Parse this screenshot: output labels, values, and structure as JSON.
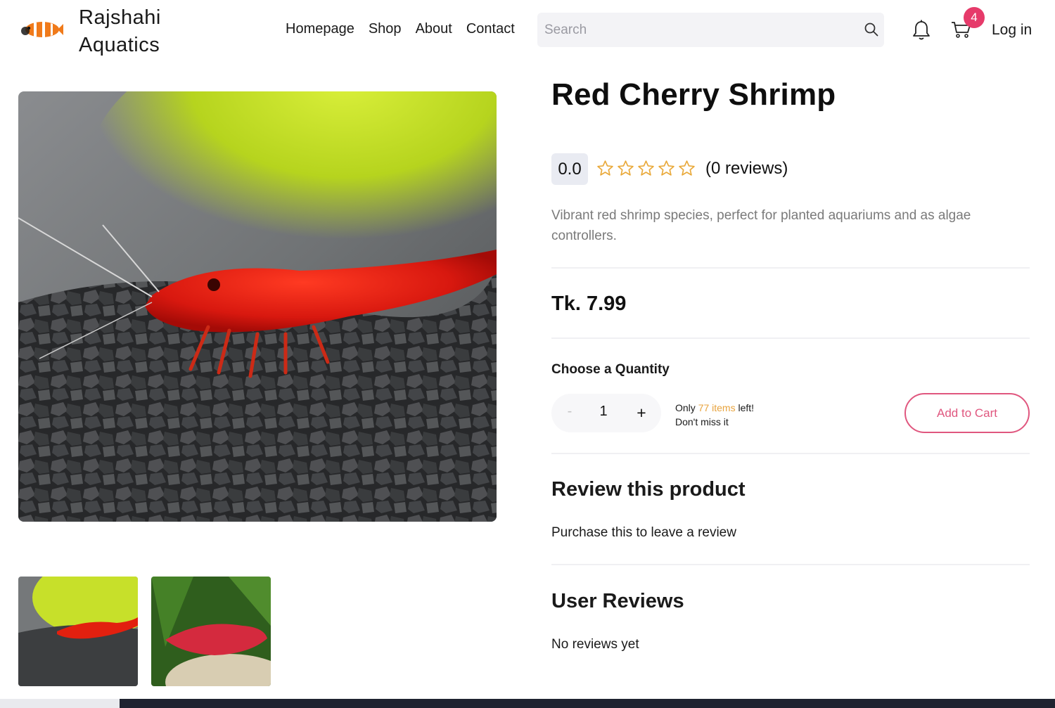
{
  "header": {
    "brand_line1": "Rajshahi",
    "brand_line2": "Aquatics",
    "nav": [
      "Homepage",
      "Shop",
      "About",
      "Contact"
    ],
    "search_placeholder": "Search",
    "cart_count": "4",
    "login_label": "Log in"
  },
  "product": {
    "title": "Red Cherry Shrimp",
    "rating": "0.0",
    "stars_filled": 0,
    "stars_total": 5,
    "reviews_label": "(0 reviews)",
    "description": "Vibrant red shrimp species, perfect for planted aquariums and as algae controllers.",
    "price": "Tk. 7.99",
    "quantity_heading": "Choose a Quantity",
    "quantity_value": "1",
    "minus_label": "-",
    "plus_label": "+",
    "stock_only": "Only",
    "stock_count": "77 items",
    "stock_left": "left!",
    "stock_note": "Don't miss it",
    "add_to_cart": "Add to Cart"
  },
  "review_section": {
    "heading": "Review this product",
    "note": "Purchase this to leave a review"
  },
  "user_reviews": {
    "heading": "User Reviews",
    "empty": "No reviews yet"
  },
  "colors": {
    "accent": "#e0577f",
    "badge": "#e63a6a",
    "stock_highlight": "#e8a33d",
    "star": "#e9a93a"
  },
  "icons": [
    "clownfish-logo-icon",
    "search-icon",
    "bell-icon",
    "cart-icon",
    "star-outline-icon"
  ]
}
